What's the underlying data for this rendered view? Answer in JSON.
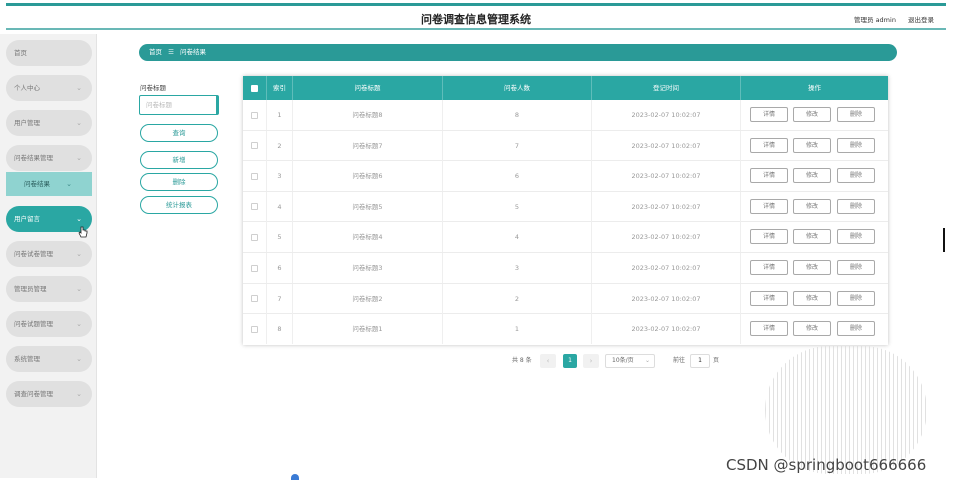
{
  "header": {
    "title": "问卷调查信息管理系统",
    "admin_label": "管理员 admin",
    "logout_label": "退出登录"
  },
  "sidebar": {
    "items": [
      {
        "label": "首页",
        "chevron": ""
      },
      {
        "label": "个人中心",
        "chevron": "⌄"
      },
      {
        "label": "用户管理",
        "chevron": "⌄"
      },
      {
        "label": "问卷结果管理",
        "chevron": "⌄"
      },
      {
        "label": "问卷结果",
        "chevron": "⌄"
      },
      {
        "label": "用户留言",
        "chevron": "⌄"
      },
      {
        "label": "问卷试卷管理",
        "chevron": "⌄"
      },
      {
        "label": "管理员管理",
        "chevron": "⌄"
      },
      {
        "label": "问卷试题管理",
        "chevron": "⌄"
      },
      {
        "label": "系统管理",
        "chevron": "⌄"
      },
      {
        "label": "调查问卷管理",
        "chevron": "⌄"
      }
    ]
  },
  "breadcrumb": {
    "home": "首页",
    "separator": "☰",
    "current": "问卷结果"
  },
  "search": {
    "label": "问卷标题",
    "placeholder": "问卷标题",
    "query_button": "查询",
    "add_button": "新增",
    "delete_button": "删除",
    "report_button": "统计报表"
  },
  "table": {
    "headers": {
      "index": "索引",
      "title": "问卷标题",
      "count": "问卷人数",
      "time": "登记时间",
      "actions": "操作"
    },
    "action_labels": {
      "detail": "详情",
      "edit": "修改",
      "delete": "删除"
    },
    "rows": [
      {
        "index": "1",
        "title": "问卷标题8",
        "count": "8",
        "time": "2023-02-07 10:02:07"
      },
      {
        "index": "2",
        "title": "问卷标题7",
        "count": "7",
        "time": "2023-02-07 10:02:07"
      },
      {
        "index": "3",
        "title": "问卷标题6",
        "count": "6",
        "time": "2023-02-07 10:02:07"
      },
      {
        "index": "4",
        "title": "问卷标题5",
        "count": "5",
        "time": "2023-02-07 10:02:07"
      },
      {
        "index": "5",
        "title": "问卷标题4",
        "count": "4",
        "time": "2023-02-07 10:02:07"
      },
      {
        "index": "6",
        "title": "问卷标题3",
        "count": "3",
        "time": "2023-02-07 10:02:07"
      },
      {
        "index": "7",
        "title": "问卷标题2",
        "count": "2",
        "time": "2023-02-07 10:02:07"
      },
      {
        "index": "8",
        "title": "问卷标题1",
        "count": "1",
        "time": "2023-02-07 10:02:07"
      }
    ]
  },
  "pagination": {
    "total_text": "共 8 条",
    "prev": "‹",
    "current_page": "1",
    "next": "›",
    "page_size": "10条/页",
    "goto_label": "前往",
    "goto_value": "1",
    "page_suffix": "页"
  },
  "watermark": "CSDN @springboot666666",
  "colors": {
    "accent": "#2aa7a3",
    "accent_dark": "#2a9a97",
    "sub_menu": "#8fd3d0"
  }
}
